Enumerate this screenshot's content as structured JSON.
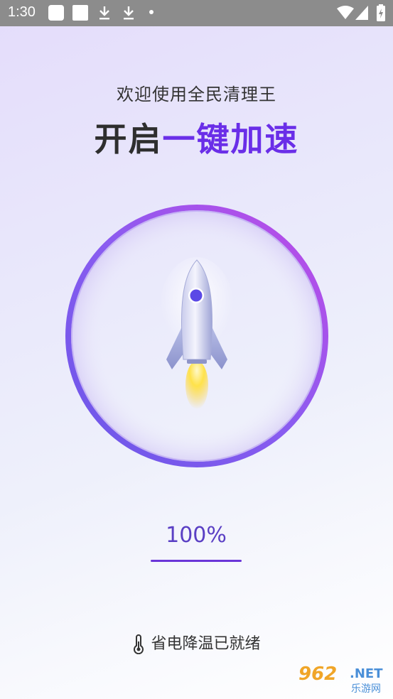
{
  "status_bar": {
    "time": "1:30",
    "icons": [
      "app-square-icon",
      "app-square-icon",
      "download-icon",
      "download-icon",
      "dot-icon",
      "wifi-icon",
      "signal-icon",
      "battery-icon"
    ]
  },
  "header": {
    "welcome": "欢迎使用全民清理王",
    "headline_plain": "开启",
    "headline_accent": "一键加速"
  },
  "booster": {
    "icon": "rocket-icon",
    "progress_label": "100%",
    "progress_value": 1.0
  },
  "footer": {
    "icon": "thermometer-icon",
    "status": "省电降温已就绪"
  },
  "watermark": {
    "number": "962",
    "suffix": ".NET",
    "site_name": "乐游网"
  },
  "colors": {
    "accent": "#6a2ee8",
    "ring_start": "#8a5cf0",
    "ring_end": "#c04ae6"
  }
}
